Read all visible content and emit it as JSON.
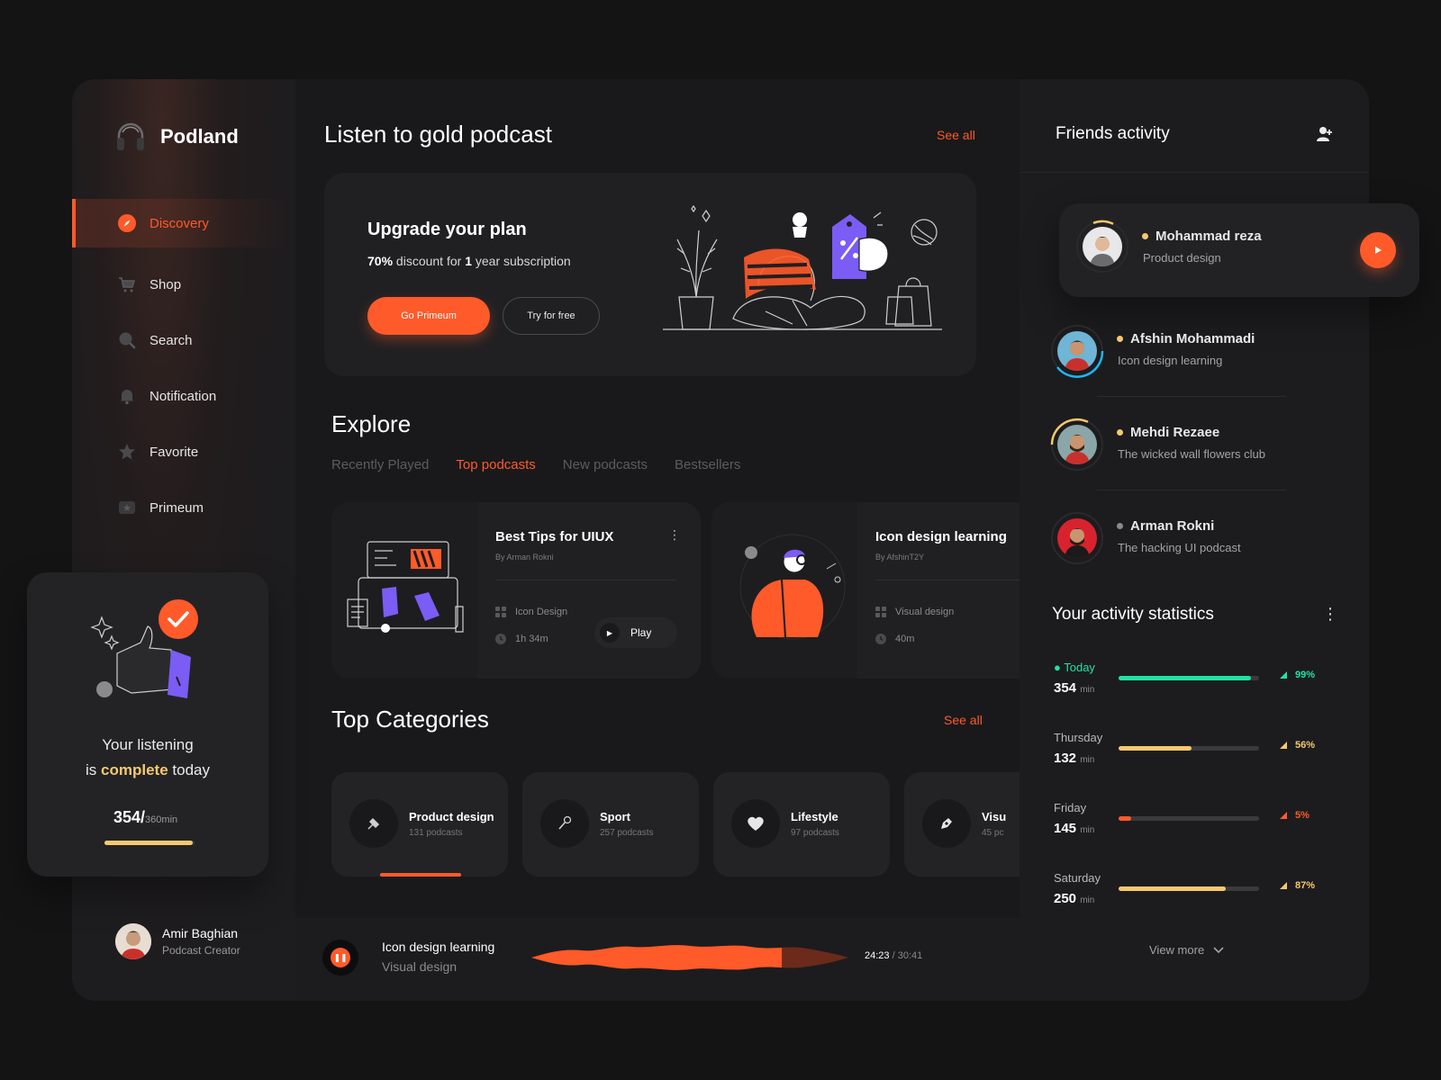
{
  "app": {
    "name": "Podland"
  },
  "sidebar": {
    "items": [
      {
        "label": "Discovery",
        "icon": "compass-icon",
        "active": true
      },
      {
        "label": "Shop",
        "icon": "cart-icon"
      },
      {
        "label": "Search",
        "icon": "search-icon"
      },
      {
        "label": "Notification",
        "icon": "bell-icon"
      },
      {
        "label": "Favorite",
        "icon": "star-icon"
      },
      {
        "label": "Primeum",
        "icon": "premium-icon"
      }
    ],
    "listening": {
      "line1": "Your listening",
      "line2_pre": "is",
      "highlight": "complete",
      "line2_post": "today",
      "count": "354/",
      "total": "360min",
      "progress": 0.98
    },
    "profile": {
      "name": "Amir Baghian",
      "role": "Podcast Creator"
    }
  },
  "main": {
    "title": "Listen to gold podcast",
    "see_all": "See all",
    "upgrade": {
      "title": "Upgrade your plan",
      "pct": "70%",
      "text_mid": " discount for ",
      "years": "1",
      "text_end": " year subscription",
      "primary_btn": "Go Primeum",
      "secondary_btn": "Try for free"
    },
    "explore": {
      "title": "Explore",
      "tabs": [
        "Recently Played",
        "Top podcasts",
        "New podcasts",
        "Bestsellers"
      ],
      "active_tab": 1,
      "podcasts": [
        {
          "title": "Best Tips for UIUX",
          "by": "By Arman Rokni",
          "category": "Icon Design",
          "duration": "1h 34m",
          "action": "Play"
        },
        {
          "title": "Icon design learning",
          "by": "By AfshinT2Y",
          "category": "Visual design",
          "duration": "40m"
        }
      ]
    },
    "categories": {
      "title": "Top Categories",
      "see_all": "See all",
      "items": [
        {
          "name": "Product design",
          "count": "131 podcasts",
          "icon": "pen-tool-icon"
        },
        {
          "name": "Sport",
          "count": "257 podcasts",
          "icon": "badminton-icon"
        },
        {
          "name": "Lifestyle",
          "count": "97 podcasts",
          "icon": "heart-icon"
        },
        {
          "name": "Visu",
          "count": "45 pc",
          "icon": "pen-nib-icon"
        }
      ]
    },
    "player": {
      "title": "Icon design learning",
      "subtitle": "Visual design",
      "elapsed": "24:23",
      "separator": " / ",
      "total": "30:41",
      "progress": 0.79
    }
  },
  "right": {
    "friends_title": "Friends activity",
    "friends": [
      {
        "name": "Mohammad reza",
        "sub": "Product design",
        "dot": "#f6c86f"
      },
      {
        "name": "Afshin Mohammadi",
        "sub": "Icon design learning",
        "dot": "#f6c86f"
      },
      {
        "name": "Mehdi Rezaee",
        "sub": "The wicked wall flowers club",
        "dot": "#f6c86f"
      },
      {
        "name": "Arman Rokni",
        "sub": "The hacking UI podcast",
        "dot": "#8a8a8c"
      }
    ],
    "stats_title": "Your activity statistics",
    "stats": [
      {
        "day": "Today",
        "value": "354",
        "unit": "min",
        "pct": "99%",
        "fraction": 0.94,
        "color": "#20e3a1"
      },
      {
        "day": "Thursday",
        "value": "132",
        "unit": "min",
        "pct": "56%",
        "fraction": 0.52,
        "color": "#f6c86f"
      },
      {
        "day": "Friday",
        "value": "145",
        "unit": "min",
        "pct": "5%",
        "fraction": 0.09,
        "color": "#ff5a2a"
      },
      {
        "day": "Saturday",
        "value": "250",
        "unit": "min",
        "pct": "87%",
        "fraction": 0.76,
        "color": "#f6c86f"
      }
    ],
    "view_more": "View more"
  },
  "colors": {
    "accent": "#ff5a2a",
    "gold": "#f6c86f",
    "green": "#20e3a1",
    "purple": "#7b5cf5"
  }
}
